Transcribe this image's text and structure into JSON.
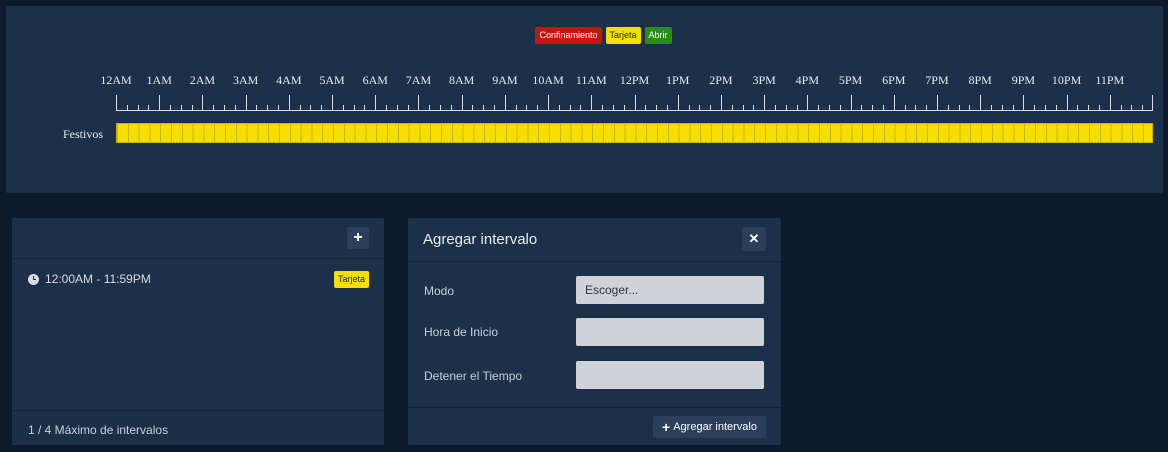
{
  "legend": [
    {
      "label": "Confinamiento",
      "color": "#c9140e"
    },
    {
      "label": "Tarjeta",
      "color": "#f5de00"
    },
    {
      "label": "Abrir",
      "color": "#2a8f10"
    }
  ],
  "timeline": {
    "hours": [
      "12AM",
      "1AM",
      "2AM",
      "3AM",
      "4AM",
      "5AM",
      "6AM",
      "7AM",
      "8AM",
      "9AM",
      "10AM",
      "11AM",
      "12PM",
      "1PM",
      "2PM",
      "3PM",
      "4PM",
      "5PM",
      "6PM",
      "7PM",
      "8PM",
      "9PM",
      "10PM",
      "11PM"
    ],
    "rows": [
      {
        "label": "Festivos",
        "mode": "Tarjeta",
        "color": "#f5de00",
        "start": "12:00AM",
        "end": "11:59PM"
      }
    ]
  },
  "list_panel": {
    "interval_text": "12:00AM - 11:59PM",
    "interval_mode": "Tarjeta",
    "footer": "1 / 4 Máximo de intervalos"
  },
  "modal": {
    "title": "Agregar intervalo",
    "mode_label": "Modo",
    "mode_value": "Escoger...",
    "start_label": "Hora de Inicio",
    "start_value": "",
    "stop_label": "Detener el Tiempo",
    "stop_value": "",
    "add_button": "Agregar intervalo"
  },
  "icons": {
    "add": "plus-icon",
    "close": "close-icon",
    "clock": "clock-icon"
  }
}
